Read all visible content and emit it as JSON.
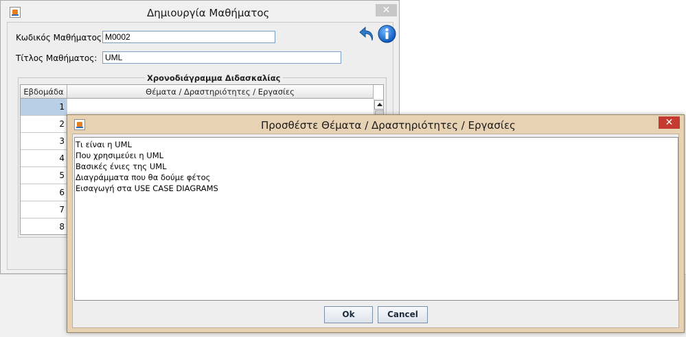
{
  "main_window": {
    "title": "Δημιουργία Μαθήματος",
    "code_label": "Κωδικός Μαθήματος:",
    "code_value": "M0002",
    "title_label": "Τίτλος Μαθήματος:",
    "title_value": "UML",
    "schedule_group_title": "Χρονοδιάγραμμα Διδασκαλίας",
    "table": {
      "columns": [
        "Εβδομάδα",
        "Θέματα / Δραστηριότητες / Εργασίες"
      ],
      "rows": [
        "1",
        "2",
        "3",
        "4",
        "5",
        "6",
        "7",
        "8"
      ],
      "selected_row": "1"
    },
    "icons": [
      "undo-icon",
      "info-icon"
    ]
  },
  "dialog": {
    "title": "Προσθέστε Θέματα / Δραστηριότητες / Εργασίες",
    "lines": [
      "Τι είναι η UML",
      "Που χρησιμεύει η UML",
      "Βασικές ένιες της UML",
      "Διαγράμματα που θα δούμε φέτος",
      "Εισαγωγή στα USE CASE DIAGRAMS"
    ],
    "ok_label": "Ok",
    "cancel_label": "Cancel"
  },
  "colors": {
    "dialog_frame": "#e8d2b4",
    "close_button": "#c43a31",
    "selected_cell": "#b8cfe5"
  }
}
